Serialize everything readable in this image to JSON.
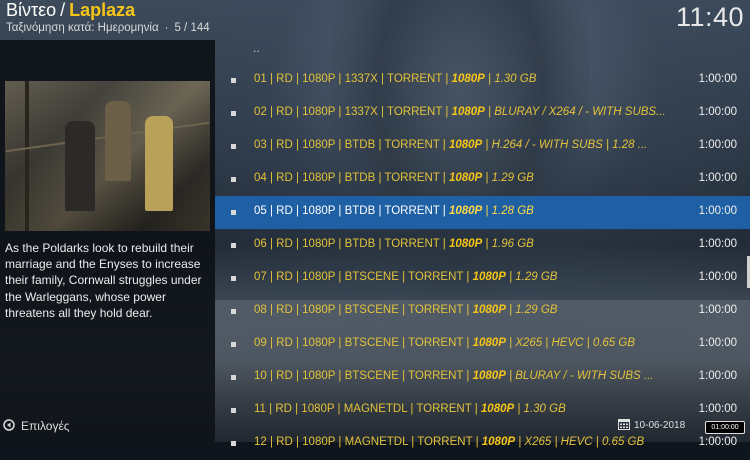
{
  "header": {
    "section": "Βίντεο",
    "separator": "/",
    "addon": "Laplaza",
    "sort_label": "Ταξινόμηση κατά: Ημερομηνία",
    "dot": "·",
    "position": "5 / 144",
    "clock": "11:40"
  },
  "info": {
    "description": "As the Poldarks look to rebuild their marriage and the Enyses to increase their family, Cornwall struggles under the Warleggans, whose power threatens all they hold dear."
  },
  "list": {
    "parent": "..",
    "items": [
      {
        "prefix": "01 | RD | 1080P | 1337X | TORRENT | ",
        "quality": "1080P",
        "suffix": "  |  1.30 GB",
        "duration": "1:00:00"
      },
      {
        "prefix": "02 | RD | 1080P | 1337X | TORRENT | ",
        "quality": "1080P",
        "suffix": "  |   BLURAY / X264 / - WITH SUBS...",
        "duration": "1:00:00"
      },
      {
        "prefix": "03 | RD | 1080P | BTDB | TORRENT | ",
        "quality": "1080P",
        "suffix": "  |   H.264 / - WITH SUBS  |  1.28 ...",
        "duration": "1:00:00"
      },
      {
        "prefix": "04 | RD | 1080P | BTDB | TORRENT | ",
        "quality": "1080P",
        "suffix": "  |  1.29 GB",
        "duration": "1:00:00"
      },
      {
        "prefix": "05 | RD | 1080P | BTDB | TORRENT | ",
        "quality": "1080P",
        "suffix": "  |  1.28 GB",
        "duration": "1:00:00"
      },
      {
        "prefix": "06 | RD | 1080P | BTDB | TORRENT | ",
        "quality": "1080P",
        "suffix": "  |  1.96 GB",
        "duration": "1:00:00"
      },
      {
        "prefix": "07 | RD | 1080P | BTSCENE | TORRENT | ",
        "quality": "1080P",
        "suffix": "  |  1.29 GB",
        "duration": "1:00:00"
      },
      {
        "prefix": "08 | RD | 1080P | BTSCENE | TORRENT | ",
        "quality": "1080P",
        "suffix": "  |  1.29 GB",
        "duration": "1:00:00"
      },
      {
        "prefix": "09 | RD | 1080P | BTSCENE | TORRENT | ",
        "quality": "1080P",
        "suffix": "  |   X265  |  HEVC  |  0.65 GB",
        "duration": "1:00:00"
      },
      {
        "prefix": "10 | RD | 1080P | BTSCENE | TORRENT | ",
        "quality": "1080P",
        "suffix": "  |   BLURAY / - WITH SUBS ...",
        "duration": "1:00:00"
      },
      {
        "prefix": "11 | RD | 1080P | MAGNETDL | TORRENT | ",
        "quality": "1080P",
        "suffix": "  |  1.30 GB",
        "duration": "1:00:00"
      },
      {
        "prefix": "12 | RD | 1080P | MAGNETDL | TORRENT | ",
        "quality": "1080P",
        "suffix": "  |  X265  |  HEVC  |  0.65 GB",
        "duration": "1:00:00"
      }
    ]
  },
  "footer": {
    "options_label": "Επιλογές",
    "date": "10-06-2018",
    "time_badge": "01:00:00"
  },
  "colors": {
    "accent": "#f5c518",
    "focus": "#1f5fa3"
  }
}
